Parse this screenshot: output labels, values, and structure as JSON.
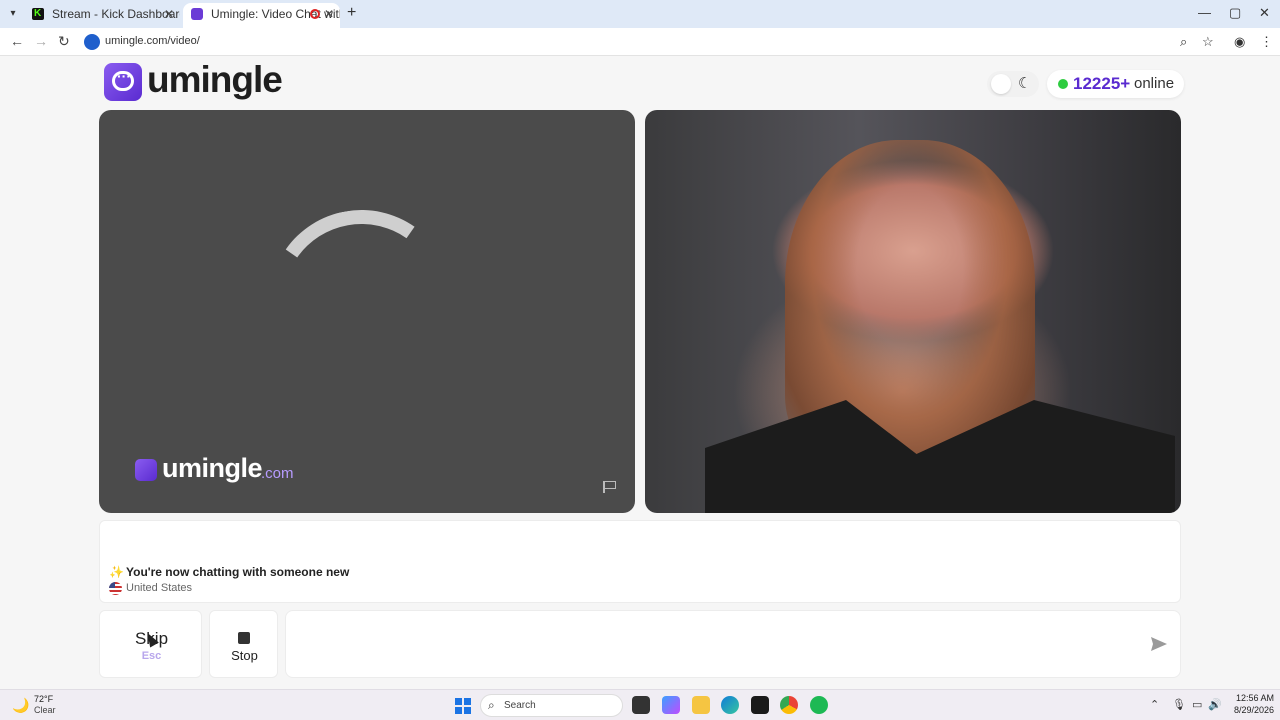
{
  "browser": {
    "tabs": [
      {
        "title": "Stream - Kick Dashboard"
      },
      {
        "title": "Umingle: Video Chat with S"
      }
    ],
    "url": "umingle.com/video/"
  },
  "header": {
    "logo_text": "umingle",
    "online_count": "12225+",
    "online_label": "online"
  },
  "video_left": {
    "watermark_name": "umingle",
    "watermark_suffix": ".com"
  },
  "chat": {
    "message": "You're now chatting with someone new",
    "country": "United States"
  },
  "controls": {
    "skip_label": "Skip",
    "skip_key": "Esc",
    "stop_label": "Stop",
    "message_placeholder": ""
  },
  "taskbar": {
    "weather_temp": "72°F",
    "weather_desc": "Clear",
    "search_label": "Search",
    "time": "12:56 AM",
    "date": "8/29/2026"
  },
  "colors": {
    "brand": "#5a2bd0",
    "online_dot": "#2ecc40",
    "video_bg": "#4b4b4b"
  }
}
